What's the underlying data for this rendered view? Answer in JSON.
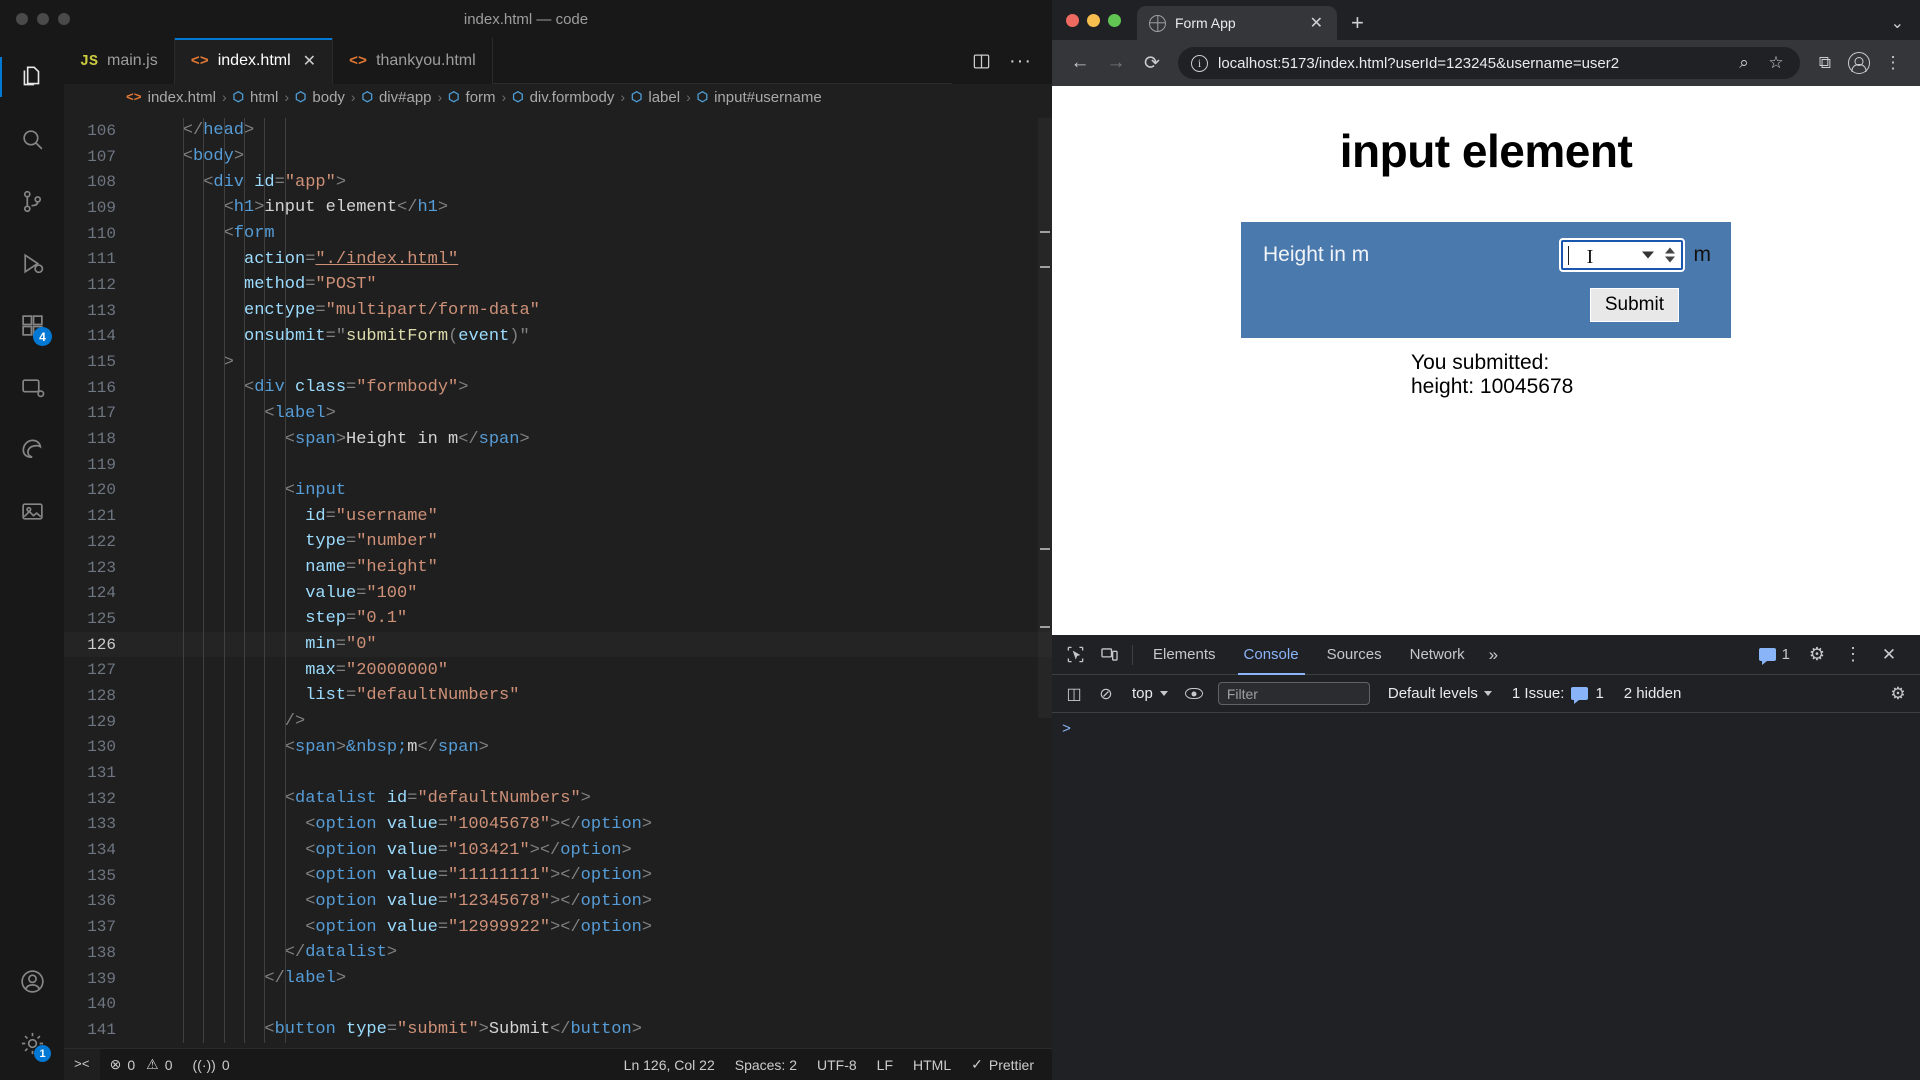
{
  "vscode": {
    "window_title": "index.html — code",
    "tabs": [
      {
        "label": "main.js",
        "icon": "js-file-icon",
        "icon_text": "JS",
        "active": false,
        "closable": false
      },
      {
        "label": "index.html",
        "icon": "html-file-icon",
        "icon_text": "<>",
        "active": true,
        "closable": true
      },
      {
        "label": "thankyou.html",
        "icon": "html-file-icon",
        "icon_text": "<>",
        "active": false,
        "closable": false
      }
    ],
    "tab_close_label": "✕",
    "editor_actions": {
      "split_label": "▯",
      "more_label": "···"
    },
    "breadcrumb": [
      {
        "label": "index.html",
        "icon": "html-file-icon"
      },
      {
        "label": "html",
        "icon": "symbol-cube-icon"
      },
      {
        "label": "body",
        "icon": "symbol-cube-icon"
      },
      {
        "label": "div#app",
        "icon": "symbol-cube-icon"
      },
      {
        "label": "form",
        "icon": "symbol-cube-icon"
      },
      {
        "label": "div.formbody",
        "icon": "symbol-cube-icon"
      },
      {
        "label": "label",
        "icon": "symbol-cube-icon"
      },
      {
        "label": "input#username",
        "icon": "symbol-cube-icon"
      }
    ],
    "activity_items": [
      {
        "name": "explorer",
        "badge": null
      },
      {
        "name": "search",
        "badge": null
      },
      {
        "name": "source-control",
        "badge": null
      },
      {
        "name": "run-and-debug",
        "badge": null
      },
      {
        "name": "extensions",
        "badge": "4"
      },
      {
        "name": "remote-explorer",
        "badge": null
      },
      {
        "name": "edge-tools",
        "badge": null
      },
      {
        "name": "image-preview",
        "badge": null
      },
      {
        "name": "accounts",
        "badge": null
      },
      {
        "name": "manage-settings",
        "badge": "1"
      }
    ],
    "code_lines": [
      {
        "n": 106,
        "indent": 2,
        "current": false,
        "tokens": [
          {
            "t": "punc",
            "v": "</"
          },
          {
            "t": "tag",
            "v": "head"
          },
          {
            "t": "punc",
            "v": ">"
          }
        ]
      },
      {
        "n": 107,
        "indent": 2,
        "current": false,
        "tokens": [
          {
            "t": "punc",
            "v": "<"
          },
          {
            "t": "tag",
            "v": "body"
          },
          {
            "t": "punc",
            "v": ">"
          }
        ]
      },
      {
        "n": 108,
        "indent": 3,
        "current": false,
        "tokens": [
          {
            "t": "punc",
            "v": "<"
          },
          {
            "t": "tag",
            "v": "div"
          },
          {
            "t": "txt",
            "v": " "
          },
          {
            "t": "attr",
            "v": "id"
          },
          {
            "t": "punc",
            "v": "="
          },
          {
            "t": "str",
            "v": "\"app\""
          },
          {
            "t": "punc",
            "v": ">"
          }
        ]
      },
      {
        "n": 109,
        "indent": 4,
        "current": false,
        "tokens": [
          {
            "t": "punc",
            "v": "<"
          },
          {
            "t": "tag",
            "v": "h1"
          },
          {
            "t": "punc",
            "v": ">"
          },
          {
            "t": "txt",
            "v": "input element"
          },
          {
            "t": "punc",
            "v": "</"
          },
          {
            "t": "tag",
            "v": "h1"
          },
          {
            "t": "punc",
            "v": ">"
          }
        ]
      },
      {
        "n": 110,
        "indent": 4,
        "current": false,
        "tokens": [
          {
            "t": "punc",
            "v": "<"
          },
          {
            "t": "tag",
            "v": "form"
          }
        ]
      },
      {
        "n": 111,
        "indent": 5,
        "current": false,
        "tokens": [
          {
            "t": "attr",
            "v": "action"
          },
          {
            "t": "punc",
            "v": "="
          },
          {
            "t": "link",
            "v": "\"./index.html\""
          }
        ]
      },
      {
        "n": 112,
        "indent": 5,
        "current": false,
        "tokens": [
          {
            "t": "attr",
            "v": "method"
          },
          {
            "t": "punc",
            "v": "="
          },
          {
            "t": "str",
            "v": "\"POST\""
          }
        ]
      },
      {
        "n": 113,
        "indent": 5,
        "current": false,
        "tokens": [
          {
            "t": "attr",
            "v": "enctype"
          },
          {
            "t": "punc",
            "v": "="
          },
          {
            "t": "str",
            "v": "\"multipart/form-data\""
          }
        ]
      },
      {
        "n": 114,
        "indent": 5,
        "current": false,
        "tokens": [
          {
            "t": "attr",
            "v": "onsubmit"
          },
          {
            "t": "punc",
            "v": "=\""
          },
          {
            "t": "fn",
            "v": "submitForm"
          },
          {
            "t": "punc",
            "v": "("
          },
          {
            "t": "attr",
            "v": "event"
          },
          {
            "t": "punc",
            "v": ")\""
          }
        ]
      },
      {
        "n": 115,
        "indent": 4,
        "current": false,
        "tokens": [
          {
            "t": "punc",
            "v": ">"
          }
        ]
      },
      {
        "n": 116,
        "indent": 5,
        "current": false,
        "tokens": [
          {
            "t": "punc",
            "v": "<"
          },
          {
            "t": "tag",
            "v": "div"
          },
          {
            "t": "txt",
            "v": " "
          },
          {
            "t": "attr",
            "v": "class"
          },
          {
            "t": "punc",
            "v": "="
          },
          {
            "t": "str",
            "v": "\"formbody\""
          },
          {
            "t": "punc",
            "v": ">"
          }
        ]
      },
      {
        "n": 117,
        "indent": 6,
        "current": false,
        "tokens": [
          {
            "t": "punc",
            "v": "<"
          },
          {
            "t": "tag",
            "v": "label"
          },
          {
            "t": "punc",
            "v": ">"
          }
        ]
      },
      {
        "n": 118,
        "indent": 7,
        "current": false,
        "tokens": [
          {
            "t": "punc",
            "v": "<"
          },
          {
            "t": "tag",
            "v": "span"
          },
          {
            "t": "punc",
            "v": ">"
          },
          {
            "t": "txt",
            "v": "Height in m"
          },
          {
            "t": "punc",
            "v": "</"
          },
          {
            "t": "tag",
            "v": "span"
          },
          {
            "t": "punc",
            "v": ">"
          }
        ]
      },
      {
        "n": 119,
        "indent": 0,
        "current": false,
        "tokens": []
      },
      {
        "n": 120,
        "indent": 7,
        "current": false,
        "tokens": [
          {
            "t": "punc",
            "v": "<"
          },
          {
            "t": "tag",
            "v": "input"
          }
        ]
      },
      {
        "n": 121,
        "indent": 8,
        "current": false,
        "tokens": [
          {
            "t": "attr",
            "v": "id"
          },
          {
            "t": "punc",
            "v": "="
          },
          {
            "t": "str",
            "v": "\"username\""
          }
        ]
      },
      {
        "n": 122,
        "indent": 8,
        "current": false,
        "tokens": [
          {
            "t": "attr",
            "v": "type"
          },
          {
            "t": "punc",
            "v": "="
          },
          {
            "t": "str",
            "v": "\"number\""
          }
        ]
      },
      {
        "n": 123,
        "indent": 8,
        "current": false,
        "tokens": [
          {
            "t": "attr",
            "v": "name"
          },
          {
            "t": "punc",
            "v": "="
          },
          {
            "t": "str",
            "v": "\"height\""
          }
        ]
      },
      {
        "n": 124,
        "indent": 8,
        "current": false,
        "tokens": [
          {
            "t": "attr",
            "v": "value"
          },
          {
            "t": "punc",
            "v": "="
          },
          {
            "t": "str",
            "v": "\"100\""
          }
        ]
      },
      {
        "n": 125,
        "indent": 8,
        "current": false,
        "tokens": [
          {
            "t": "attr",
            "v": "step"
          },
          {
            "t": "punc",
            "v": "="
          },
          {
            "t": "str",
            "v": "\"0.1\""
          }
        ]
      },
      {
        "n": 126,
        "indent": 8,
        "current": true,
        "tokens": [
          {
            "t": "attr",
            "v": "min"
          },
          {
            "t": "punc",
            "v": "="
          },
          {
            "t": "str",
            "v": "\"0\""
          }
        ]
      },
      {
        "n": 127,
        "indent": 8,
        "current": false,
        "tokens": [
          {
            "t": "attr",
            "v": "max"
          },
          {
            "t": "punc",
            "v": "="
          },
          {
            "t": "str",
            "v": "\"20000000\""
          }
        ]
      },
      {
        "n": 128,
        "indent": 8,
        "current": false,
        "tokens": [
          {
            "t": "attr",
            "v": "list"
          },
          {
            "t": "punc",
            "v": "="
          },
          {
            "t": "str",
            "v": "\"defaultNumbers\""
          }
        ]
      },
      {
        "n": 129,
        "indent": 7,
        "current": false,
        "tokens": [
          {
            "t": "punc",
            "v": "/>"
          }
        ]
      },
      {
        "n": 130,
        "indent": 7,
        "current": false,
        "tokens": [
          {
            "t": "punc",
            "v": "<"
          },
          {
            "t": "tag",
            "v": "span"
          },
          {
            "t": "punc",
            "v": ">"
          },
          {
            "t": "ent",
            "v": "&nbsp;"
          },
          {
            "t": "txt",
            "v": "m"
          },
          {
            "t": "punc",
            "v": "</"
          },
          {
            "t": "tag",
            "v": "span"
          },
          {
            "t": "punc",
            "v": ">"
          }
        ]
      },
      {
        "n": 131,
        "indent": 0,
        "current": false,
        "tokens": []
      },
      {
        "n": 132,
        "indent": 7,
        "current": false,
        "tokens": [
          {
            "t": "punc",
            "v": "<"
          },
          {
            "t": "tag",
            "v": "datalist"
          },
          {
            "t": "txt",
            "v": " "
          },
          {
            "t": "attr",
            "v": "id"
          },
          {
            "t": "punc",
            "v": "="
          },
          {
            "t": "str",
            "v": "\"defaultNumbers\""
          },
          {
            "t": "punc",
            "v": ">"
          }
        ]
      },
      {
        "n": 133,
        "indent": 8,
        "current": false,
        "tokens": [
          {
            "t": "punc",
            "v": "<"
          },
          {
            "t": "tag",
            "v": "option"
          },
          {
            "t": "txt",
            "v": " "
          },
          {
            "t": "attr",
            "v": "value"
          },
          {
            "t": "punc",
            "v": "="
          },
          {
            "t": "str",
            "v": "\"10045678\""
          },
          {
            "t": "punc",
            "v": "></"
          },
          {
            "t": "tag",
            "v": "option"
          },
          {
            "t": "punc",
            "v": ">"
          }
        ]
      },
      {
        "n": 134,
        "indent": 8,
        "current": false,
        "tokens": [
          {
            "t": "punc",
            "v": "<"
          },
          {
            "t": "tag",
            "v": "option"
          },
          {
            "t": "txt",
            "v": " "
          },
          {
            "t": "attr",
            "v": "value"
          },
          {
            "t": "punc",
            "v": "="
          },
          {
            "t": "str",
            "v": "\"103421\""
          },
          {
            "t": "punc",
            "v": "></"
          },
          {
            "t": "tag",
            "v": "option"
          },
          {
            "t": "punc",
            "v": ">"
          }
        ]
      },
      {
        "n": 135,
        "indent": 8,
        "current": false,
        "tokens": [
          {
            "t": "punc",
            "v": "<"
          },
          {
            "t": "tag",
            "v": "option"
          },
          {
            "t": "txt",
            "v": " "
          },
          {
            "t": "attr",
            "v": "value"
          },
          {
            "t": "punc",
            "v": "="
          },
          {
            "t": "str",
            "v": "\"11111111\""
          },
          {
            "t": "punc",
            "v": "></"
          },
          {
            "t": "tag",
            "v": "option"
          },
          {
            "t": "punc",
            "v": ">"
          }
        ]
      },
      {
        "n": 136,
        "indent": 8,
        "current": false,
        "tokens": [
          {
            "t": "punc",
            "v": "<"
          },
          {
            "t": "tag",
            "v": "option"
          },
          {
            "t": "txt",
            "v": " "
          },
          {
            "t": "attr",
            "v": "value"
          },
          {
            "t": "punc",
            "v": "="
          },
          {
            "t": "str",
            "v": "\"12345678\""
          },
          {
            "t": "punc",
            "v": "></"
          },
          {
            "t": "tag",
            "v": "option"
          },
          {
            "t": "punc",
            "v": ">"
          }
        ]
      },
      {
        "n": 137,
        "indent": 8,
        "current": false,
        "tokens": [
          {
            "t": "punc",
            "v": "<"
          },
          {
            "t": "tag",
            "v": "option"
          },
          {
            "t": "txt",
            "v": " "
          },
          {
            "t": "attr",
            "v": "value"
          },
          {
            "t": "punc",
            "v": "="
          },
          {
            "t": "str",
            "v": "\"12999922\""
          },
          {
            "t": "punc",
            "v": "></"
          },
          {
            "t": "tag",
            "v": "option"
          },
          {
            "t": "punc",
            "v": ">"
          }
        ]
      },
      {
        "n": 138,
        "indent": 7,
        "current": false,
        "tokens": [
          {
            "t": "punc",
            "v": "</"
          },
          {
            "t": "tag",
            "v": "datalist"
          },
          {
            "t": "punc",
            "v": ">"
          }
        ]
      },
      {
        "n": 139,
        "indent": 6,
        "current": false,
        "tokens": [
          {
            "t": "punc",
            "v": "</"
          },
          {
            "t": "tag",
            "v": "label"
          },
          {
            "t": "punc",
            "v": ">"
          }
        ]
      },
      {
        "n": 140,
        "indent": 0,
        "current": false,
        "tokens": []
      },
      {
        "n": 141,
        "indent": 6,
        "current": false,
        "tokens": [
          {
            "t": "punc",
            "v": "<"
          },
          {
            "t": "tag",
            "v": "button"
          },
          {
            "t": "txt",
            "v": " "
          },
          {
            "t": "attr",
            "v": "type"
          },
          {
            "t": "punc",
            "v": "="
          },
          {
            "t": "str",
            "v": "\"submit\""
          },
          {
            "t": "punc",
            "v": ">"
          },
          {
            "t": "txt",
            "v": "Submit"
          },
          {
            "t": "punc",
            "v": "</"
          },
          {
            "t": "tag",
            "v": "button"
          },
          {
            "t": "punc",
            "v": ">"
          }
        ]
      }
    ],
    "statusbar": {
      "remote_label": "><",
      "errors": "0",
      "warnings": "0",
      "ports": "0",
      "cursor": "Ln 126, Col 22",
      "spaces": "Spaces: 2",
      "encoding": "UTF-8",
      "eol": "LF",
      "language": "HTML",
      "formatter": "Prettier",
      "formatter_check": "✓"
    }
  },
  "browser": {
    "tab": {
      "title": "Form App",
      "close_label": "✕"
    },
    "new_tab_label": "+",
    "tab_list_label": "⌄",
    "toolbar": {
      "back_label": "←",
      "forward_label": "→",
      "reload_label": "⟳",
      "url": "localhost:5173/index.html?userId=123245&username=user2",
      "info_label": "i",
      "zoom_label": "⌕",
      "bookmark_label": "☆",
      "extensions_label": "⧉",
      "menu_label": "⋮"
    },
    "page": {
      "heading": "input element",
      "form": {
        "label": "Height in m",
        "input_value": "",
        "unit": "m",
        "submit_label": "Submit",
        "background_color": "#4a79ad"
      },
      "result": {
        "line1": "You submitted:",
        "line2": "height: 10045678"
      }
    }
  },
  "devtools": {
    "tabs": [
      {
        "label": "Elements",
        "active": false
      },
      {
        "label": "Console",
        "active": true
      },
      {
        "label": "Sources",
        "active": false
      },
      {
        "label": "Network",
        "active": false
      }
    ],
    "more_tabs_label": "»",
    "inspect_label": "inspect-element-icon",
    "device_label": "device-toolbar-icon",
    "message_count": "1",
    "settings_label": "⚙",
    "dock_menu_label": "⋮",
    "close_label": "✕",
    "filterbar": {
      "sidebar_label": "◫",
      "clear_label": "⊘",
      "context": "top",
      "eye_label": "live-expression-icon",
      "filter_placeholder": "Filter",
      "levels": "Default levels",
      "issues_label": "1 Issue:",
      "issues_count": "1",
      "hidden": "2 hidden",
      "settings_label": "⚙"
    },
    "prompt": ">"
  }
}
